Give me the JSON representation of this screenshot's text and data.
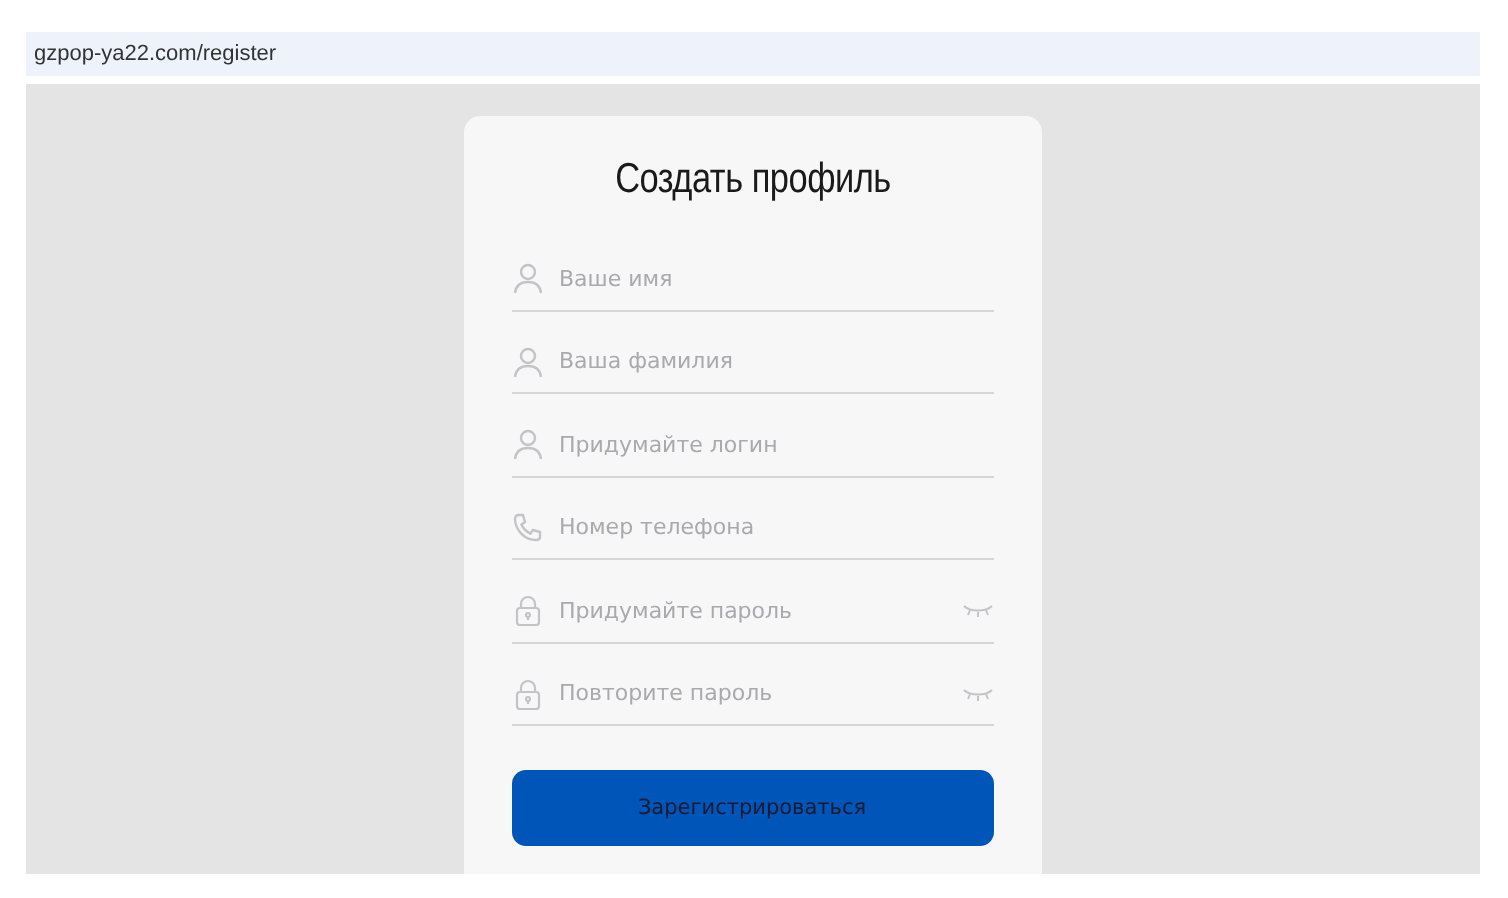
{
  "address_bar": {
    "url": "gzpop-ya22.com/register"
  },
  "form": {
    "title": "Создать профиль",
    "fields": [
      {
        "kind": "person",
        "placeholder": "Ваше имя"
      },
      {
        "kind": "person",
        "placeholder": "Ваша фамилия"
      },
      {
        "kind": "person",
        "placeholder": "Придумайте логин"
      },
      {
        "kind": "phone",
        "placeholder": "Номер телефона"
      },
      {
        "kind": "password",
        "placeholder": "Придумайте пароль"
      },
      {
        "kind": "password",
        "placeholder": "Повторите пароль"
      }
    ],
    "submit_button": "Зарегистрироваться"
  }
}
